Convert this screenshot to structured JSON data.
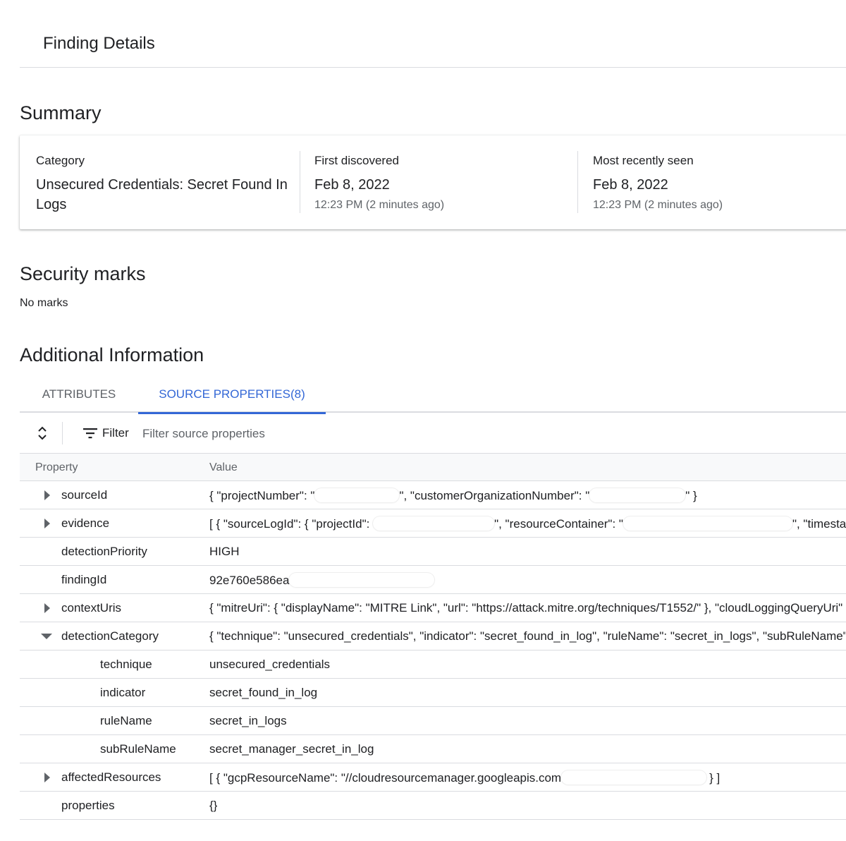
{
  "header": {
    "title": "Finding Details"
  },
  "summary": {
    "title": "Summary",
    "category": {
      "label": "Category",
      "value": "Unsecured Credentials: Secret Found In Logs"
    },
    "first_discovered": {
      "label": "First discovered",
      "date": "Feb 8, 2022",
      "time": "12:23 PM (2 minutes ago)"
    },
    "most_recently_seen": {
      "label": "Most recently seen",
      "date": "Feb 8, 2022",
      "time": "12:23 PM (2 minutes ago)"
    }
  },
  "security_marks": {
    "title": "Security marks",
    "empty_text": "No marks"
  },
  "additional_info": {
    "title": "Additional Information",
    "tabs": [
      {
        "label": "ATTRIBUTES",
        "active": false
      },
      {
        "label": "SOURCE PROPERTIES(8)",
        "active": true
      }
    ]
  },
  "toolbar": {
    "filter_label": "Filter",
    "filter_placeholder": "Filter source properties",
    "icons": {
      "expand": "unfold-icon",
      "filter": "filter-icon"
    }
  },
  "table": {
    "columns": {
      "property": "Property",
      "value": "Value"
    },
    "rows": [
      {
        "property": "sourceId",
        "level": 0,
        "expander": "collapsed",
        "v1": "{ \"projectNumber\": \"",
        "v2": "\", \"customerOrganizationNumber\": \"",
        "v3": "\" }"
      },
      {
        "property": "evidence",
        "level": 0,
        "expander": "collapsed",
        "v1": "[ { \"sourceLogId\": { \"projectId\": ",
        "v2": "\", \"resourceContainer\": \"",
        "v3": "\", \"timestamp\""
      },
      {
        "property": "detectionPriority",
        "level": 0,
        "expander": "none",
        "v1": "HIGH"
      },
      {
        "property": "findingId",
        "level": 0,
        "expander": "none",
        "v1": "92e760e586ea"
      },
      {
        "property": "contextUris",
        "level": 0,
        "expander": "collapsed",
        "v1": "{ \"mitreUri\": { \"displayName\": \"MITRE Link\", \"url\": \"https://attack.mitre.org/techniques/T1552/\" }, \"cloudLoggingQueryUri\""
      },
      {
        "property": "detectionCategory",
        "level": 0,
        "expander": "expanded",
        "v1": "{ \"technique\": \"unsecured_credentials\", \"indicator\": \"secret_found_in_log\", \"ruleName\": \"secret_in_logs\", \"subRuleName\""
      },
      {
        "property": "technique",
        "level": 1,
        "expander": "none",
        "v1": "unsecured_credentials"
      },
      {
        "property": "indicator",
        "level": 1,
        "expander": "none",
        "v1": "secret_found_in_log"
      },
      {
        "property": "ruleName",
        "level": 1,
        "expander": "none",
        "v1": "secret_in_logs"
      },
      {
        "property": "subRuleName",
        "level": 1,
        "expander": "none",
        "v1": "secret_manager_secret_in_log"
      },
      {
        "property": "affectedResources",
        "level": 0,
        "expander": "collapsed",
        "v1": "[ { \"gcpResourceName\": \"//cloudresourcemanager.googleapis.com",
        "v2": "} ]"
      },
      {
        "property": "properties",
        "level": 0,
        "expander": "none",
        "v1": "{}"
      }
    ]
  },
  "colors": {
    "accent": "#3367d6",
    "text": "#202124",
    "muted": "#5f6368",
    "border": "#dadce0"
  }
}
